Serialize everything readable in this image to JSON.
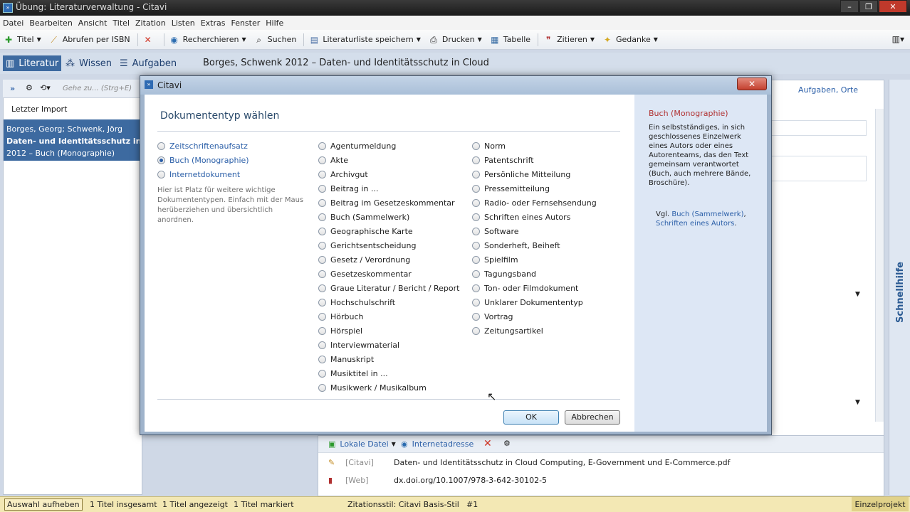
{
  "window": {
    "title": "Übung: Literaturverwaltung - Citavi"
  },
  "menu": [
    "Datei",
    "Bearbeiten",
    "Ansicht",
    "Titel",
    "Zitation",
    "Listen",
    "Extras",
    "Fenster",
    "Hilfe"
  ],
  "toolbar": {
    "titel": "Titel",
    "isbn": "Abrufen per ISBN",
    "recherchieren": "Recherchieren",
    "suchen": "Suchen",
    "literaturliste": "Literaturliste speichern",
    "drucken": "Drucken",
    "tabelle": "Tabelle",
    "zitieren": "Zitieren",
    "gedanke": "Gedanke"
  },
  "nav": {
    "literatur": "Literatur",
    "wissen": "Wissen",
    "aufgaben": "Aufgaben"
  },
  "doc_title": "Borges, Schwenk 2012 – Daten- und Identitätsschutz in Cloud",
  "left": {
    "search_placeholder": "Gehe zu... (Strg+E)",
    "header": "Letzter Import",
    "item_line1": "Borges, Georg; Schwenk, Jörg",
    "item_line2": "Daten- und Identitätsschutz in Cloud",
    "item_line3": "2012 – Buch (Monographie)"
  },
  "right": {
    "aufgaben_orte": "Aufgaben, Orte",
    "schnellhilfe": "Schnellhilfe"
  },
  "bottom": {
    "lokale_datei": "Lokale Datei",
    "internetadresse": "Internetadresse",
    "row1_tag": "[Citavi]",
    "row1_text": "Daten- und Identitätsschutz in Cloud Computing, E-Government und E-Commerce.pdf",
    "row2_tag": "[Web]",
    "row2_text": "dx.doi.org/10.1007/978-3-642-30102-5"
  },
  "status": {
    "auswahl": "Auswahl aufheben",
    "insgesamt": "1 Titel insgesamt",
    "angezeigt": "1 Titel angezeigt",
    "markiert": "1 Titel markiert",
    "zitationsstil": "Zitationsstil: Citavi Basis-Stil",
    "nummer": "#1",
    "einzelprojekt": "Einzelprojekt"
  },
  "dialog": {
    "title": "Citavi",
    "heading": "Dokumententyp wählen",
    "favorites": [
      {
        "label": "Zeitschriftenaufsatz",
        "checked": false
      },
      {
        "label": "Buch (Monographie)",
        "checked": true
      },
      {
        "label": "Internetdokument",
        "checked": false
      }
    ],
    "hint": "Hier ist Platz für weitere wichtige Dokumententypen. Einfach mit der Maus herüberziehen und übersichtlich anordnen.",
    "col1": [
      "Agenturmeldung",
      "Akte",
      "Archivgut",
      "Beitrag in ...",
      "Beitrag im Gesetzeskommentar",
      "Buch (Sammelwerk)",
      "Geographische Karte",
      "Gerichtsentscheidung",
      "Gesetz / Verordnung",
      "Gesetzeskommentar",
      "Graue Literatur / Bericht / Report",
      "Hochschulschrift",
      "Hörbuch",
      "Hörspiel",
      "Interviewmaterial",
      "Manuskript",
      "Musiktitel in ...",
      "Musikwerk / Musikalbum"
    ],
    "col2": [
      "Norm",
      "Patentschrift",
      "Persönliche Mitteilung",
      "Pressemitteilung",
      "Radio- oder Fernsehsendung",
      "Schriften eines Autors",
      "Software",
      "Sonderheft, Beiheft",
      "Spielfilm",
      "Tagungsband",
      "Ton- oder Filmdokument",
      "Unklarer Dokumententyp",
      "Vortrag",
      "Zeitungsartikel"
    ],
    "ok": "OK",
    "cancel": "Abbrechen",
    "side_title": "Buch (Monographie)",
    "side_desc": "Ein selbstständiges, in sich geschlossenes Einzelwerk eines Autors oder eines Autorenteams, das den Text gemeinsam verantwortet (Buch, auch mehrere Bände, Broschüre).",
    "side_vgl": "Vgl.",
    "side_link1": "Buch (Sammelwerk)",
    "side_link2": "Schriften eines Autors"
  }
}
